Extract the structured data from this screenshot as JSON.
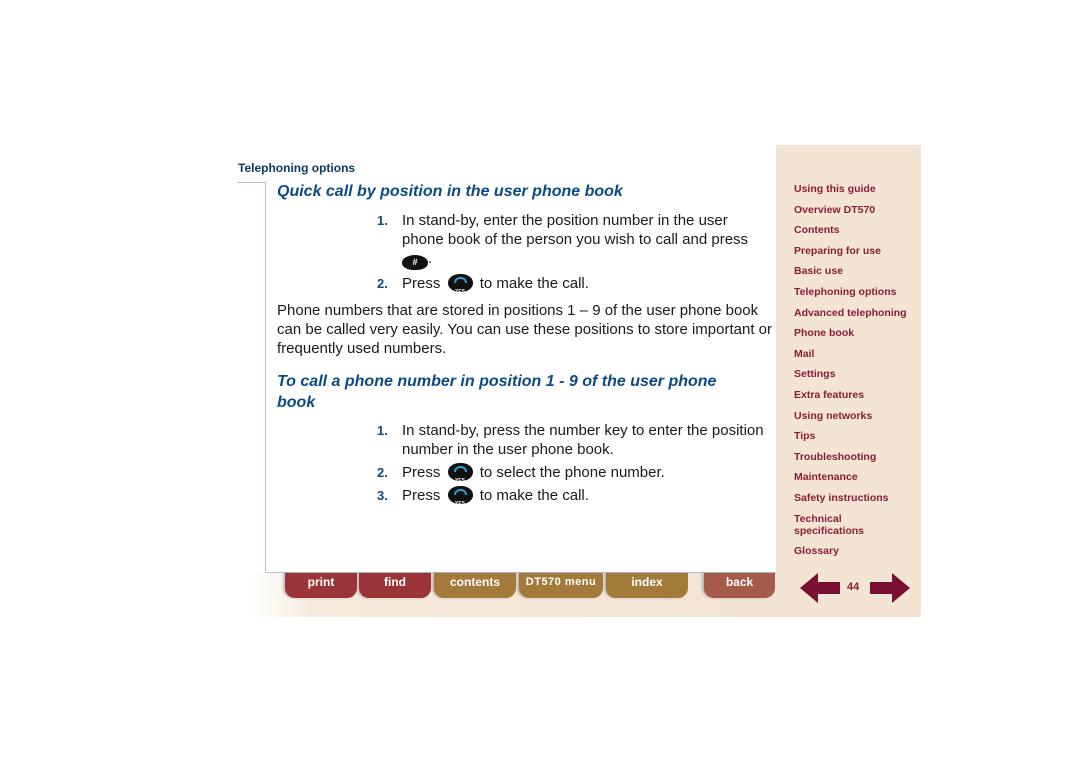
{
  "section_label": "Telephoning options",
  "heading1": "Quick call by position in the user phone book",
  "steps1": [
    {
      "num": "1.",
      "text": "In stand-by, enter the position number in the user phone book of the person you wish to call and press",
      "key": "hash",
      "suffix": "."
    },
    {
      "num": "2.",
      "prefix": "Press",
      "key": "yes",
      "text": "to make the call."
    }
  ],
  "paragraph": "Phone numbers that are stored in positions 1 – 9 of the user phone book can be called very easily. You can use these positions to store important or frequently used numbers.",
  "heading2": "To call a phone number in position 1 - 9 of the user phone book",
  "steps2": [
    {
      "num": "1.",
      "text": "In stand-by, press the number key to enter the position number in the user phone book."
    },
    {
      "num": "2.",
      "prefix": "Press",
      "key": "yes",
      "text": "to select the phone number."
    },
    {
      "num": "3.",
      "prefix": "Press",
      "key": "yes",
      "text": "to make the call."
    }
  ],
  "keys": {
    "hash_label": "#",
    "yes_label": "YES"
  },
  "bottom_tabs": {
    "print": "print",
    "find": "find",
    "contents": "contents",
    "menu": "DT570 menu",
    "index": "index",
    "back": "back"
  },
  "sidebar": {
    "items": [
      "Using this guide",
      "Overview DT570",
      "Contents",
      "Preparing for use",
      "Basic use",
      "Telephoning options",
      "Advanced telephoning",
      "Phone book",
      "Mail",
      "Settings",
      "Extra features",
      "Using networks",
      "Tips",
      "Troubleshooting",
      "Maintenance",
      "Safety instructions",
      "Technical specifications",
      "Glossary"
    ]
  },
  "page_number": "44",
  "colors": {
    "heading": "#0b4a86",
    "sidebar_link": "#8b1d3b",
    "sidebar_bg": "#f3e4d3",
    "tab_red": "#9a3436",
    "tab_gold": "#a37a3a",
    "tab_back": "#a65a48",
    "arrow": "#7a0f34"
  }
}
